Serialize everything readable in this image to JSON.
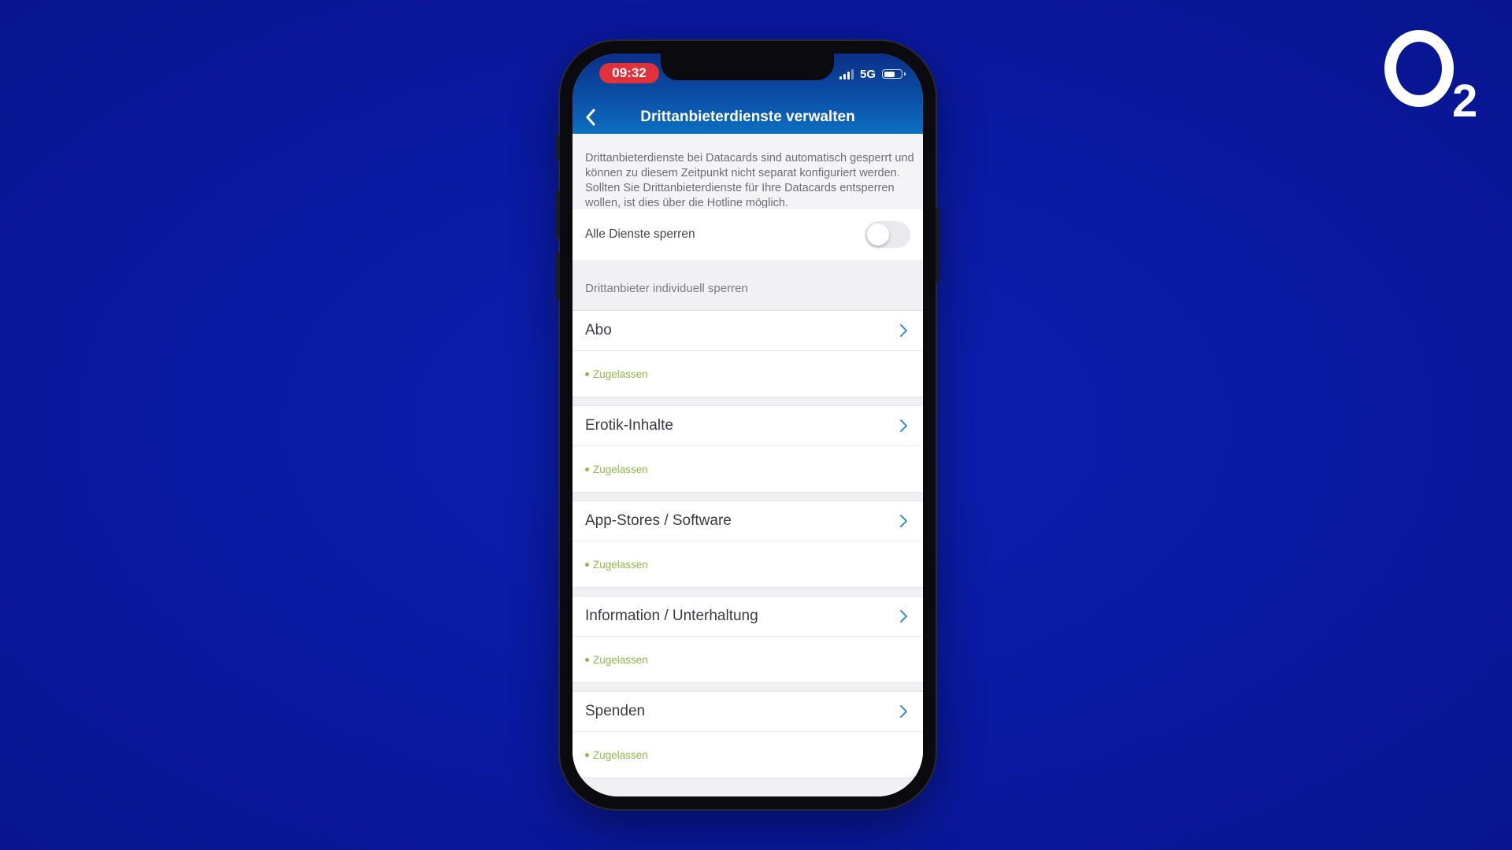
{
  "brand": {
    "logo_letter": "O",
    "logo_subscript": "2"
  },
  "status_bar": {
    "time": "09:32",
    "network": "5G"
  },
  "header": {
    "title": "Drittanbieterdienste verwalten"
  },
  "info_text": "Drittanbieterdienste bei Datacards sind automatisch gesperrt und können zu diesem Zeitpunkt nicht separat konfiguriert werden. Sollten Sie Drittanbieterdienste für Ihre Datacards entsperren wollen, ist dies über die Hotline möglich.",
  "block_all": {
    "label": "Alle Dienste sperren",
    "enabled": false
  },
  "section_title": "Drittanbieter individuell sperren",
  "services": [
    {
      "name": "Abo",
      "status": "Zugelassen"
    },
    {
      "name": "Erotik-Inhalte",
      "status": "Zugelassen"
    },
    {
      "name": "App-Stores / Software",
      "status": "Zugelassen"
    },
    {
      "name": "Information / Unterhaltung",
      "status": "Zugelassen"
    },
    {
      "name": "Spenden",
      "status": "Zugelassen"
    }
  ],
  "colors": {
    "background": "#0a1ba8",
    "header_gradient_top": "#0a2f88",
    "header_gradient_bottom": "#0d6fc0",
    "time_pill": "#e0323a",
    "status_green": "#8fb84a",
    "chevron": "#3a8ed0"
  }
}
